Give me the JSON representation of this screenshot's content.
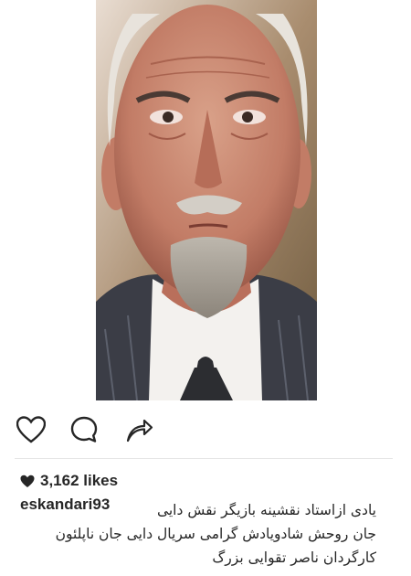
{
  "post": {
    "image": {
      "subject": "portrait-photo"
    },
    "actions": {
      "like_icon": "heart-outline-icon",
      "comment_icon": "comment-bubble-icon",
      "share_icon": "share-arrow-icon"
    },
    "likes": {
      "icon": "heart-filled-icon",
      "text": "3,162 likes"
    },
    "caption": {
      "username": "eskandari93",
      "lines": [
        "یادی ازاستاد نقشینه بازیگر نقش دایی",
        "جان روحش شادویادش گرامی  سریال دایی جان ناپلئون",
        "کارگردان ناصر تقوایی بزرگ"
      ]
    }
  },
  "colors": {
    "text": "#262626",
    "divider": "#e6e6e6",
    "background": "#ffffff"
  }
}
